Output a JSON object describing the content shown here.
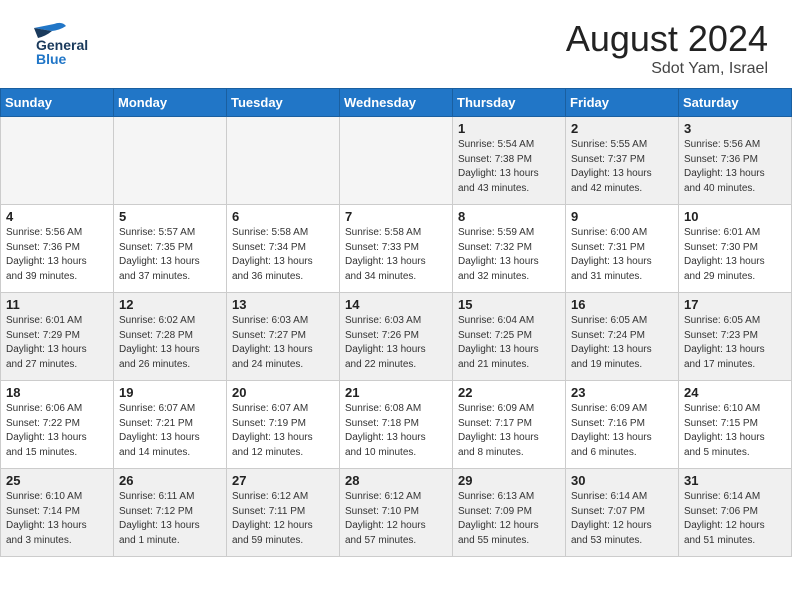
{
  "header": {
    "logo_general": "General",
    "logo_blue": "Blue",
    "month_title": "August 2024",
    "location": "Sdot Yam, Israel"
  },
  "weekdays": [
    "Sunday",
    "Monday",
    "Tuesday",
    "Wednesday",
    "Thursday",
    "Friday",
    "Saturday"
  ],
  "weeks": [
    [
      {
        "day": "",
        "info": "",
        "empty": true
      },
      {
        "day": "",
        "info": "",
        "empty": true
      },
      {
        "day": "",
        "info": "",
        "empty": true
      },
      {
        "day": "",
        "info": "",
        "empty": true
      },
      {
        "day": "1",
        "info": "Sunrise: 5:54 AM\nSunset: 7:38 PM\nDaylight: 13 hours\nand 43 minutes.",
        "empty": false
      },
      {
        "day": "2",
        "info": "Sunrise: 5:55 AM\nSunset: 7:37 PM\nDaylight: 13 hours\nand 42 minutes.",
        "empty": false
      },
      {
        "day": "3",
        "info": "Sunrise: 5:56 AM\nSunset: 7:36 PM\nDaylight: 13 hours\nand 40 minutes.",
        "empty": false
      }
    ],
    [
      {
        "day": "4",
        "info": "Sunrise: 5:56 AM\nSunset: 7:36 PM\nDaylight: 13 hours\nand 39 minutes.",
        "empty": false
      },
      {
        "day": "5",
        "info": "Sunrise: 5:57 AM\nSunset: 7:35 PM\nDaylight: 13 hours\nand 37 minutes.",
        "empty": false
      },
      {
        "day": "6",
        "info": "Sunrise: 5:58 AM\nSunset: 7:34 PM\nDaylight: 13 hours\nand 36 minutes.",
        "empty": false
      },
      {
        "day": "7",
        "info": "Sunrise: 5:58 AM\nSunset: 7:33 PM\nDaylight: 13 hours\nand 34 minutes.",
        "empty": false
      },
      {
        "day": "8",
        "info": "Sunrise: 5:59 AM\nSunset: 7:32 PM\nDaylight: 13 hours\nand 32 minutes.",
        "empty": false
      },
      {
        "day": "9",
        "info": "Sunrise: 6:00 AM\nSunset: 7:31 PM\nDaylight: 13 hours\nand 31 minutes.",
        "empty": false
      },
      {
        "day": "10",
        "info": "Sunrise: 6:01 AM\nSunset: 7:30 PM\nDaylight: 13 hours\nand 29 minutes.",
        "empty": false
      }
    ],
    [
      {
        "day": "11",
        "info": "Sunrise: 6:01 AM\nSunset: 7:29 PM\nDaylight: 13 hours\nand 27 minutes.",
        "empty": false
      },
      {
        "day": "12",
        "info": "Sunrise: 6:02 AM\nSunset: 7:28 PM\nDaylight: 13 hours\nand 26 minutes.",
        "empty": false
      },
      {
        "day": "13",
        "info": "Sunrise: 6:03 AM\nSunset: 7:27 PM\nDaylight: 13 hours\nand 24 minutes.",
        "empty": false
      },
      {
        "day": "14",
        "info": "Sunrise: 6:03 AM\nSunset: 7:26 PM\nDaylight: 13 hours\nand 22 minutes.",
        "empty": false
      },
      {
        "day": "15",
        "info": "Sunrise: 6:04 AM\nSunset: 7:25 PM\nDaylight: 13 hours\nand 21 minutes.",
        "empty": false
      },
      {
        "day": "16",
        "info": "Sunrise: 6:05 AM\nSunset: 7:24 PM\nDaylight: 13 hours\nand 19 minutes.",
        "empty": false
      },
      {
        "day": "17",
        "info": "Sunrise: 6:05 AM\nSunset: 7:23 PM\nDaylight: 13 hours\nand 17 minutes.",
        "empty": false
      }
    ],
    [
      {
        "day": "18",
        "info": "Sunrise: 6:06 AM\nSunset: 7:22 PM\nDaylight: 13 hours\nand 15 minutes.",
        "empty": false
      },
      {
        "day": "19",
        "info": "Sunrise: 6:07 AM\nSunset: 7:21 PM\nDaylight: 13 hours\nand 14 minutes.",
        "empty": false
      },
      {
        "day": "20",
        "info": "Sunrise: 6:07 AM\nSunset: 7:19 PM\nDaylight: 13 hours\nand 12 minutes.",
        "empty": false
      },
      {
        "day": "21",
        "info": "Sunrise: 6:08 AM\nSunset: 7:18 PM\nDaylight: 13 hours\nand 10 minutes.",
        "empty": false
      },
      {
        "day": "22",
        "info": "Sunrise: 6:09 AM\nSunset: 7:17 PM\nDaylight: 13 hours\nand 8 minutes.",
        "empty": false
      },
      {
        "day": "23",
        "info": "Sunrise: 6:09 AM\nSunset: 7:16 PM\nDaylight: 13 hours\nand 6 minutes.",
        "empty": false
      },
      {
        "day": "24",
        "info": "Sunrise: 6:10 AM\nSunset: 7:15 PM\nDaylight: 13 hours\nand 5 minutes.",
        "empty": false
      }
    ],
    [
      {
        "day": "25",
        "info": "Sunrise: 6:10 AM\nSunset: 7:14 PM\nDaylight: 13 hours\nand 3 minutes.",
        "empty": false
      },
      {
        "day": "26",
        "info": "Sunrise: 6:11 AM\nSunset: 7:12 PM\nDaylight: 13 hours\nand 1 minute.",
        "empty": false
      },
      {
        "day": "27",
        "info": "Sunrise: 6:12 AM\nSunset: 7:11 PM\nDaylight: 12 hours\nand 59 minutes.",
        "empty": false
      },
      {
        "day": "28",
        "info": "Sunrise: 6:12 AM\nSunset: 7:10 PM\nDaylight: 12 hours\nand 57 minutes.",
        "empty": false
      },
      {
        "day": "29",
        "info": "Sunrise: 6:13 AM\nSunset: 7:09 PM\nDaylight: 12 hours\nand 55 minutes.",
        "empty": false
      },
      {
        "day": "30",
        "info": "Sunrise: 6:14 AM\nSunset: 7:07 PM\nDaylight: 12 hours\nand 53 minutes.",
        "empty": false
      },
      {
        "day": "31",
        "info": "Sunrise: 6:14 AM\nSunset: 7:06 PM\nDaylight: 12 hours\nand 51 minutes.",
        "empty": false
      }
    ]
  ]
}
